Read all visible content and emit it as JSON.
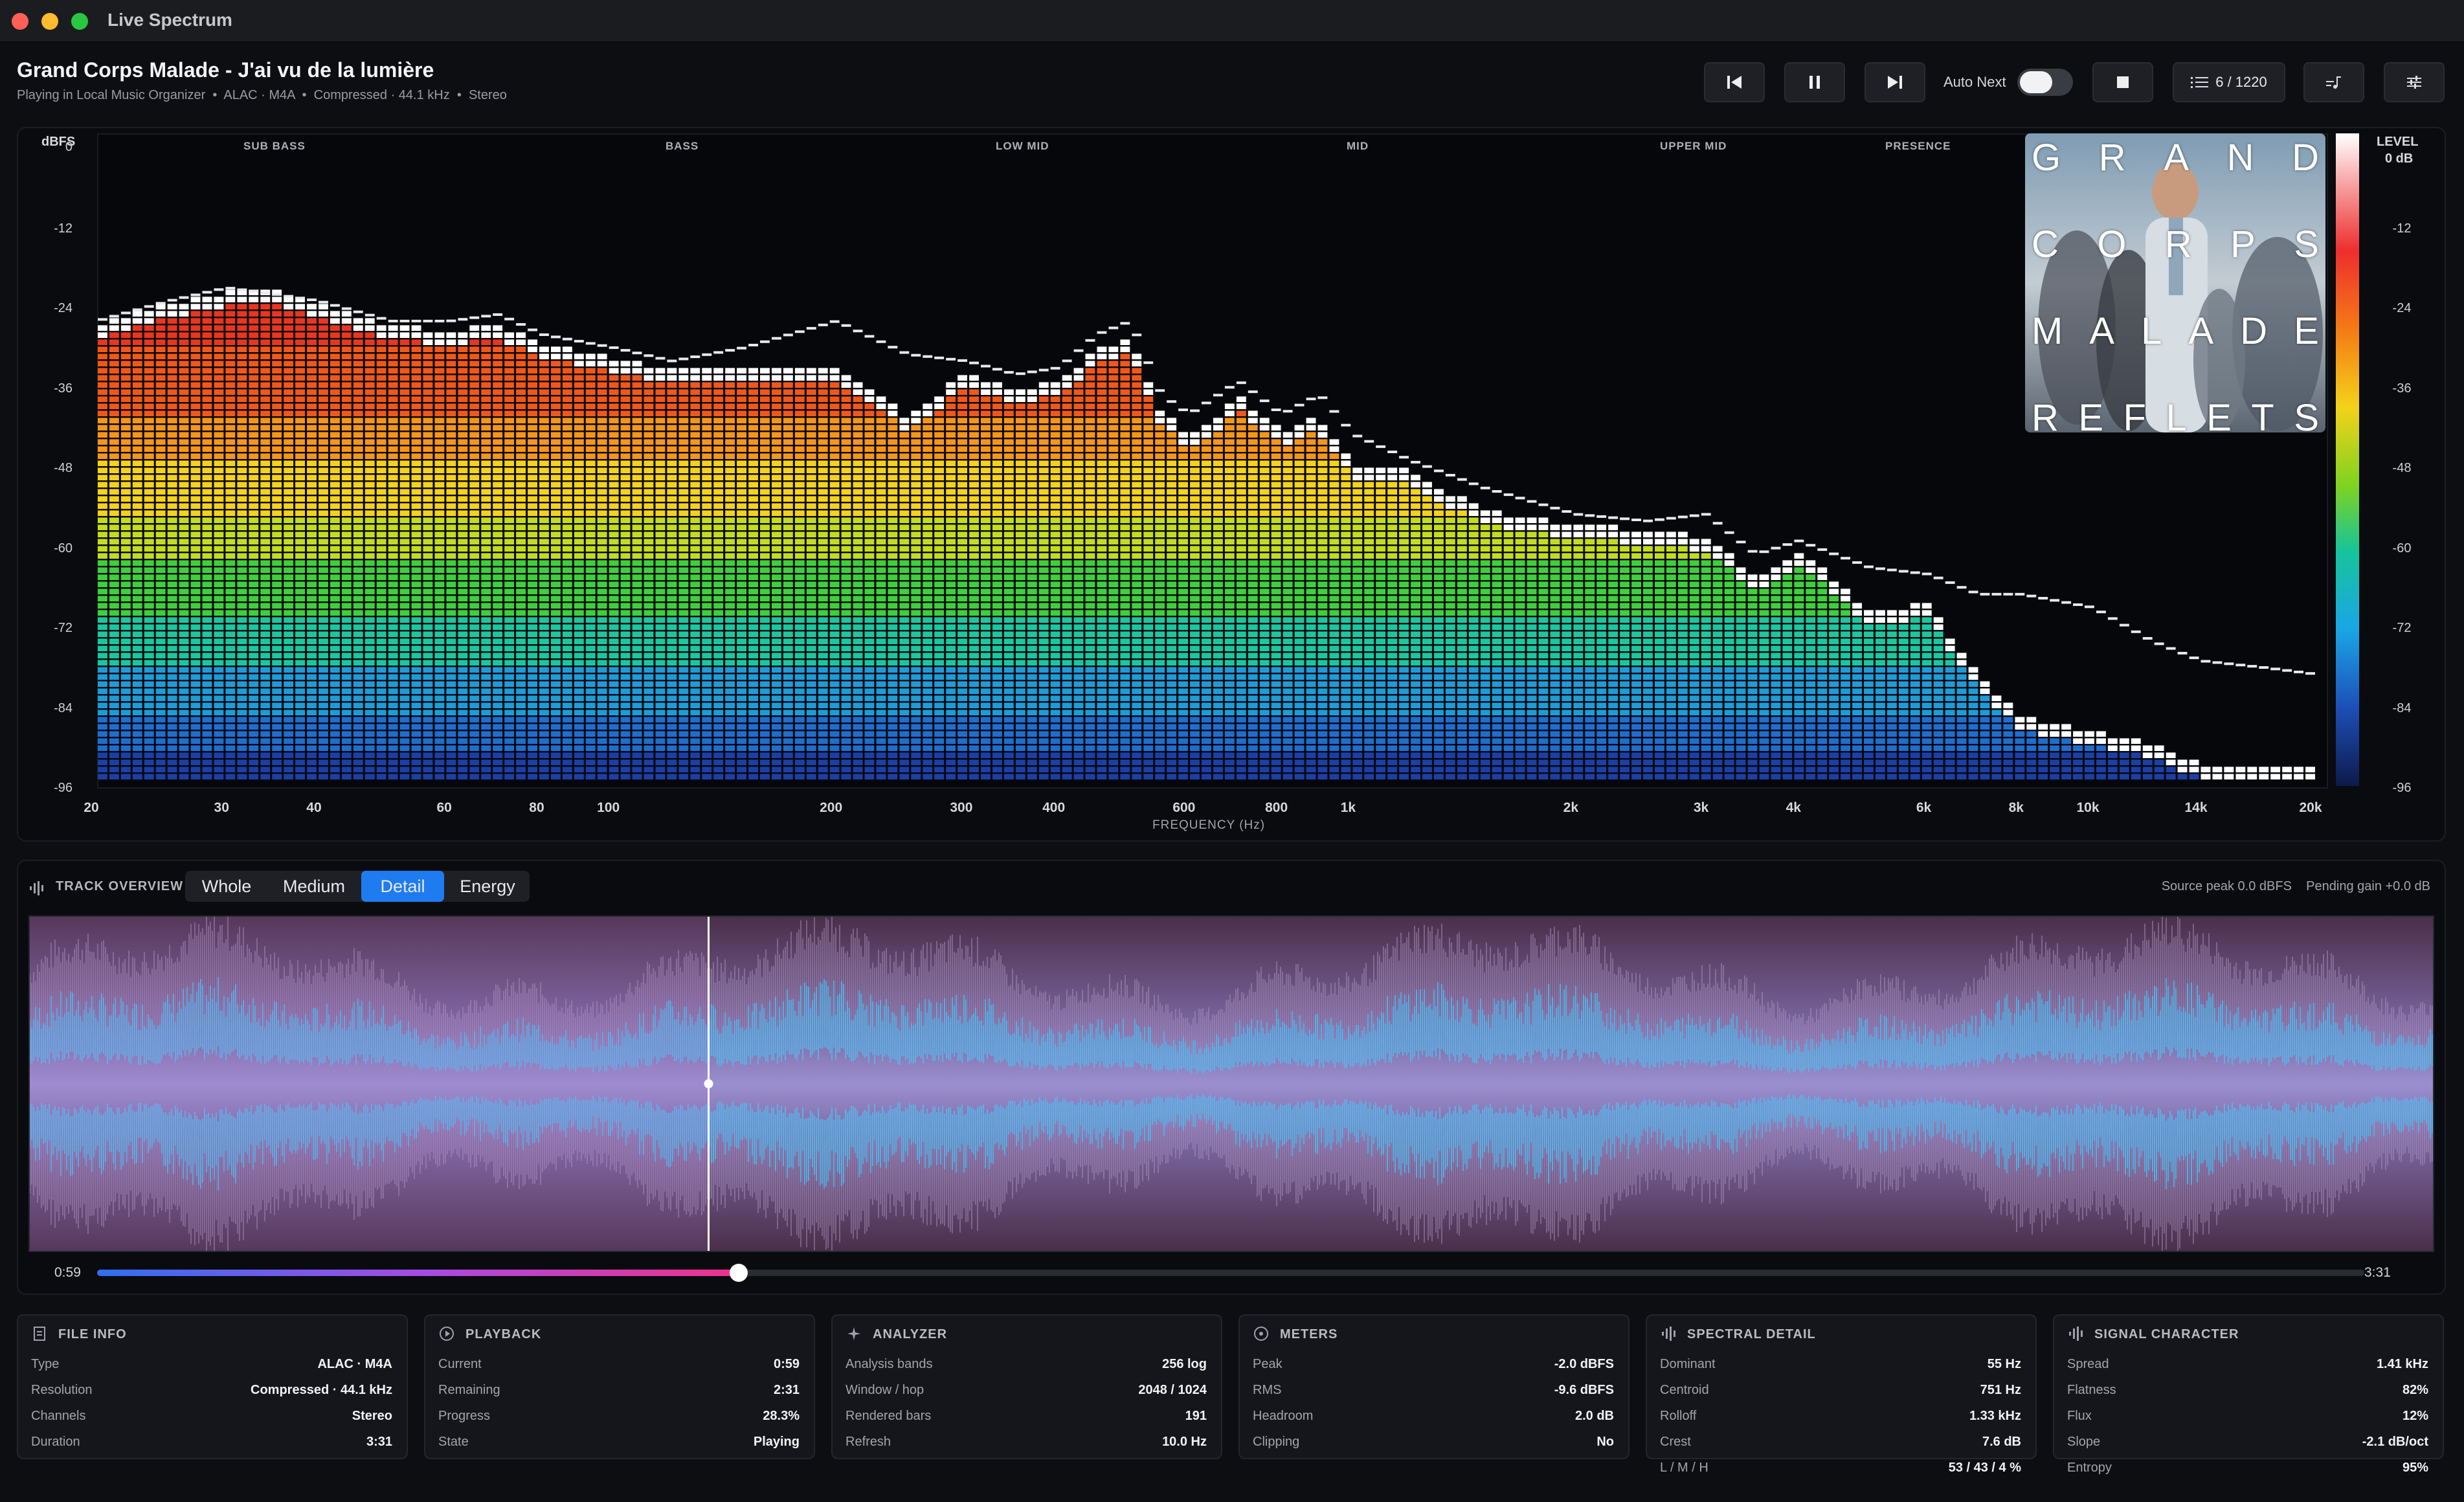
{
  "window": {
    "title": "Live Spectrum"
  },
  "track": {
    "title": "Grand Corps Malade - J'ai vu de la lumière",
    "meta": "Playing in Local Music Organizer  •  ALAC · M4A  •  Compressed · 44.1 kHz  •  Stereo"
  },
  "toolbar": {
    "auto_next_label": "Auto Next",
    "auto_next_on": false,
    "queue_label": "6 / 1220"
  },
  "spectrum": {
    "y_unit": "dBFS",
    "y_ticks": [
      "0",
      "-12",
      "-24",
      "-36",
      "-48",
      "-60",
      "-72",
      "-84",
      "-96"
    ],
    "level_label": "LEVEL",
    "level_top": "0 dB",
    "level_ticks": [
      "-12",
      "-24",
      "-36",
      "-48",
      "-60",
      "-72",
      "-84",
      "-96"
    ],
    "bands": [
      "SUB BASS",
      "BASS",
      "LOW MID",
      "MID",
      "UPPER MID",
      "PRESENCE"
    ],
    "x_ticks": [
      "20",
      "30",
      "40",
      "60",
      "80",
      "100",
      "200",
      "300",
      "400",
      "600",
      "800",
      "1k",
      "2k",
      "3k",
      "4k",
      "6k",
      "8k",
      "10k",
      "14k",
      "20k"
    ],
    "x_label": "FREQUENCY (Hz)",
    "album_art_text": [
      "G R A N D",
      "C O R P S",
      "M A L A D E",
      "R E F L E T S"
    ]
  },
  "chart_data": {
    "type": "bar",
    "title": "",
    "xlabel": "FREQUENCY (Hz)",
    "ylabel": "dBFS",
    "ylim": [
      -96,
      0
    ],
    "x_scale": "log",
    "xlim": [
      20,
      20000
    ],
    "x": [
      20,
      25,
      30,
      35,
      40,
      50,
      60,
      70,
      80,
      100,
      120,
      150,
      200,
      250,
      300,
      350,
      400,
      450,
      500,
      550,
      600,
      700,
      800,
      900,
      1000,
      1200,
      1500,
      2000,
      2500,
      3000,
      3500,
      4000,
      5000,
      6000,
      7000,
      8000,
      10000,
      12000,
      14000,
      17000,
      20000
    ],
    "values": [
      -28,
      -25,
      -23,
      -23,
      -25,
      -28,
      -29,
      -28,
      -31,
      -33,
      -35,
      -34,
      -34,
      -42,
      -35,
      -38,
      -36,
      -32,
      -30,
      -41,
      -45,
      -39,
      -44,
      -42,
      -49,
      -50,
      -56,
      -58,
      -59,
      -60,
      -66,
      -62,
      -71,
      -70,
      -81,
      -87,
      -89,
      -91,
      -94,
      -94,
      -94
    ],
    "peaks": [
      -27,
      -24,
      -22,
      -23,
      -24,
      -27,
      -27,
      -26,
      -29,
      -31,
      -33,
      -31,
      -27,
      -32,
      -33,
      -35,
      -34,
      -29,
      -27,
      -38,
      -41,
      -36,
      -41,
      -38,
      -44,
      -48,
      -52,
      -56,
      -57,
      -56,
      -62,
      -60,
      -64,
      -65,
      -68,
      -68,
      -70,
      -75,
      -78,
      -79,
      -80
    ]
  },
  "overview": {
    "title": "TRACK OVERVIEW",
    "tabs": [
      "Whole",
      "Medium",
      "Detail",
      "Energy"
    ],
    "active_tab": "Detail",
    "source_peak": "Source peak 0.0 dBFS",
    "pending_gain": "Pending gain +0.0 dB",
    "current_time": "0:59",
    "duration": "3:31",
    "progress": 0.283
  },
  "cards": [
    {
      "title": "FILE INFO",
      "icon": "document-icon",
      "rows": [
        [
          "Type",
          "ALAC · M4A"
        ],
        [
          "Resolution",
          "Compressed · 44.1 kHz"
        ],
        [
          "Channels",
          "Stereo"
        ],
        [
          "Duration",
          "3:31"
        ]
      ]
    },
    {
      "title": "PLAYBACK",
      "icon": "play-circle-icon",
      "rows": [
        [
          "Current",
          "0:59"
        ],
        [
          "Remaining",
          "2:31"
        ],
        [
          "Progress",
          "28.3%"
        ],
        [
          "State",
          "Playing"
        ]
      ]
    },
    {
      "title": "ANALYZER",
      "icon": "sparkle-icon",
      "rows": [
        [
          "Analysis bands",
          "256 log"
        ],
        [
          "Window / hop",
          "2048 / 1024"
        ],
        [
          "Rendered bars",
          "191"
        ],
        [
          "Refresh",
          "10.0 Hz"
        ]
      ]
    },
    {
      "title": "METERS",
      "icon": "gauge-icon",
      "rows": [
        [
          "Peak",
          "-2.0 dBFS"
        ],
        [
          "RMS",
          "-9.6 dBFS"
        ],
        [
          "Headroom",
          "2.0 dB"
        ],
        [
          "Clipping",
          "No"
        ]
      ]
    },
    {
      "title": "SPECTRAL DETAIL",
      "icon": "waveform-icon",
      "rows": [
        [
          "Dominant",
          "55 Hz"
        ],
        [
          "Centroid",
          "751 Hz"
        ],
        [
          "Rolloff",
          "1.33 kHz"
        ],
        [
          "Crest",
          "7.6 dB"
        ],
        [
          "L / M / H",
          "53 / 43 / 4 %"
        ]
      ]
    },
    {
      "title": "SIGNAL CHARACTER",
      "icon": "waveform-icon",
      "rows": [
        [
          "Spread",
          "1.41 kHz"
        ],
        [
          "Flatness",
          "82%"
        ],
        [
          "Flux",
          "12%"
        ],
        [
          "Slope",
          "-2.1 dB/oct"
        ],
        [
          "Entropy",
          "95%"
        ]
      ]
    }
  ]
}
